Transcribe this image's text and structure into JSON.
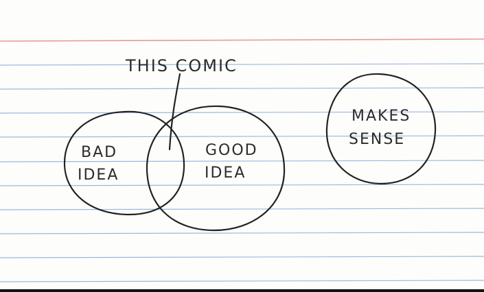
{
  "labels": {
    "caption": "THIS COMIC",
    "bad_line1": "BAD",
    "bad_line2": "IDEA",
    "good_line1": "GOOD",
    "good_line2": "IDEA",
    "sense_line1": "MAKES",
    "sense_line2": "SENSE"
  },
  "colors": {
    "paper": "#fdfdfb",
    "rule_line": "#9fb6dd",
    "margin_line": "#e59a9a",
    "ink": "#222222"
  }
}
